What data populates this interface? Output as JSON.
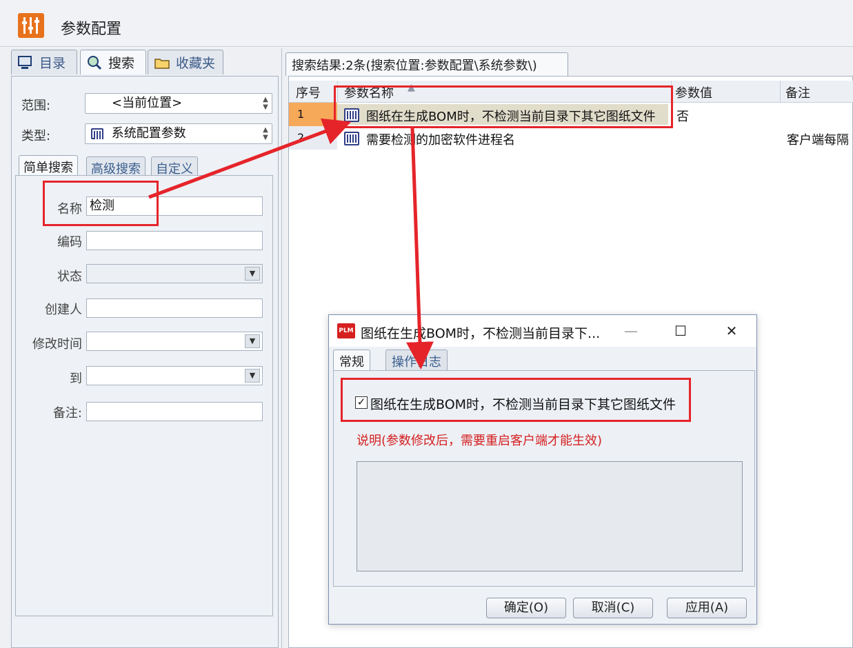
{
  "header": {
    "title": "参数配置"
  },
  "left": {
    "tabs": [
      "目录",
      "搜索",
      "收藏夹"
    ],
    "scope_label": "范围:",
    "scope_value": "<当前位置>",
    "type_label": "类型:",
    "type_value": "系统配置参数",
    "search_tabs": [
      "简单搜索",
      "高级搜索",
      "自定义"
    ],
    "fields": {
      "name_label": "名称",
      "name_value": "检测",
      "code_label": "编码",
      "status_label": "状态",
      "creator_label": "创建人",
      "modified_label": "修改时间",
      "to_label": "到",
      "remark_label": "备注:"
    }
  },
  "results": {
    "tab_label": "搜索结果:2条(搜索位置:参数配置\\系统参数\\)",
    "columns": [
      "序号",
      "参数名称",
      "参数值",
      "备注"
    ],
    "rows": [
      {
        "index": "1",
        "name": "图纸在生成BOM时，不检测当前目录下其它图纸文件",
        "value": "否",
        "remark": ""
      },
      {
        "index": "2",
        "name": "需要检测的加密软件进程名",
        "value": "",
        "remark": "客户端每隔"
      }
    ]
  },
  "dialog": {
    "logo": "PLM",
    "title": "图纸在生成BOM时，不检测当前目录下...",
    "window_buttons": {
      "minimize": "—",
      "maximize": "☐",
      "close": "✕"
    },
    "tabs": [
      "常规",
      "操作日志"
    ],
    "checkbox_label": "图纸在生成BOM时，不检测当前目录下其它图纸文件",
    "checkbox_checked": true,
    "note": "说明(参数修改后，需要重启客户端才能生效)",
    "buttons": {
      "ok": "确定(O)",
      "cancel": "取消(C)",
      "apply": "应用(A)"
    }
  },
  "colors": {
    "accent": "#e8721c",
    "annotation": "#e5242a",
    "selected_row": "#f7a95a",
    "note_text": "#d42020"
  }
}
